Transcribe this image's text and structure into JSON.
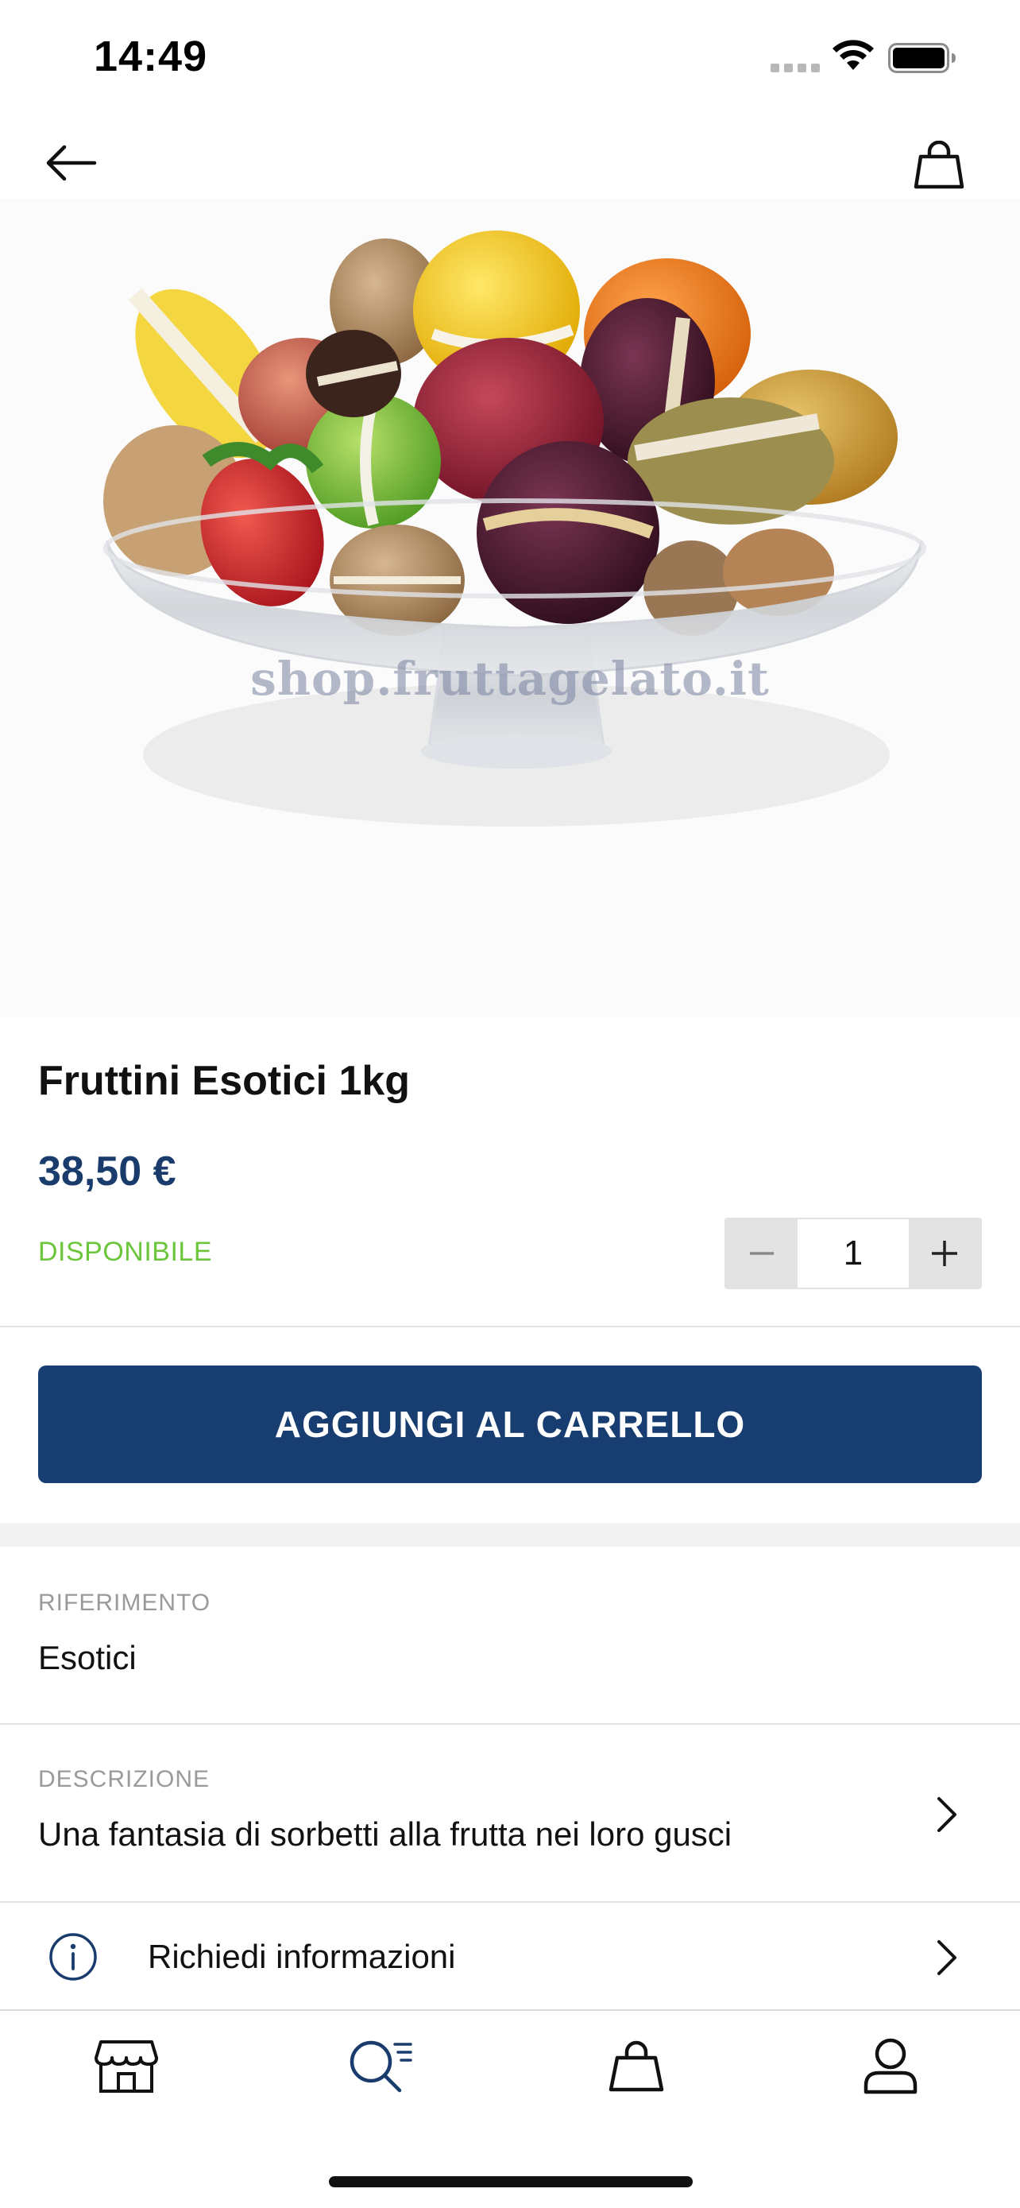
{
  "status_bar": {
    "time": "14:49"
  },
  "header": {
    "back_icon": "arrow-left-icon",
    "cart_icon": "shopping-bag-icon"
  },
  "product": {
    "image_watermark": "shop.fruttagelato.it",
    "title": "Fruttini Esotici 1kg",
    "price": "38,50 €",
    "availability": "DISPONIBILE",
    "quantity": "1",
    "colors": {
      "price": "#1a3c6c",
      "availability": "#6cc63c",
      "primary_button": "#183d70"
    }
  },
  "actions": {
    "add_to_cart_label": "AGGIUNGI AL CARRELLO"
  },
  "details": {
    "reference_label": "RIFERIMENTO",
    "reference_value": "Esotici",
    "description_label": "DESCRIZIONE",
    "description_value": "Una fantasia di sorbetti alla frutta nei loro gusci",
    "info_label": "Richiedi informazioni"
  },
  "tab_bar": {
    "tabs": [
      {
        "icon": "store-icon",
        "active": false
      },
      {
        "icon": "search-list-icon",
        "active": true
      },
      {
        "icon": "shopping-bag-icon",
        "active": false
      },
      {
        "icon": "user-icon",
        "active": false
      }
    ]
  }
}
